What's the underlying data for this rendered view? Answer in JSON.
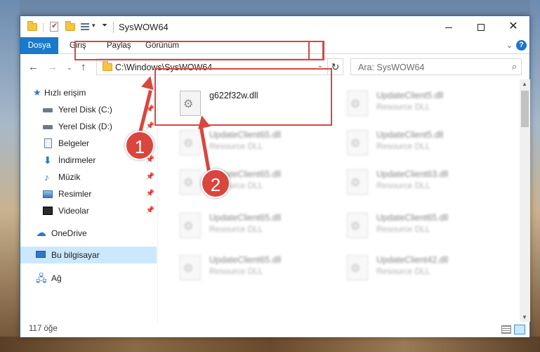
{
  "window": {
    "title": "SysWOW64",
    "minimize_glyph": "—",
    "close_glyph": "✕"
  },
  "quick_access_toolbar": {
    "dropdown_glyph": "▾",
    "customize_glyph": "⏷"
  },
  "ribbon": {
    "tabs": [
      {
        "label": "Dosya",
        "active": true
      },
      {
        "label": "Giriş"
      },
      {
        "label": "Paylaş"
      },
      {
        "label": "Görünüm"
      }
    ],
    "expand_glyph": "⌄",
    "help_glyph": "?"
  },
  "navigation": {
    "back_glyph": "←",
    "forward_glyph": "→",
    "recent_glyph": "⌄",
    "up_glyph": "↑",
    "address_path": "C:\\Windows\\SysWOW64",
    "address_dropdown_glyph": "⌄",
    "refresh_glyph": "↻",
    "search_placeholder": "Ara: SysWOW64",
    "search_glyph": "⌕"
  },
  "sidebar": {
    "items": [
      {
        "label": "Hızlı erişim",
        "icon": "star-icon",
        "pinned": false
      },
      {
        "label": "Yerel Disk (C:)",
        "icon": "disk-icon",
        "pinned": true
      },
      {
        "label": "Yerel Disk (D:)",
        "icon": "disk-icon",
        "pinned": true
      },
      {
        "label": "Belgeler",
        "icon": "document-icon",
        "pinned": true
      },
      {
        "label": "İndirmeler",
        "icon": "download-icon",
        "pinned": true
      },
      {
        "label": "Müzik",
        "icon": "music-icon",
        "pinned": true
      },
      {
        "label": "Resimler",
        "icon": "pictures-icon",
        "pinned": true
      },
      {
        "label": "Videolar",
        "icon": "video-icon",
        "pinned": true
      },
      {
        "label": "OneDrive",
        "icon": "cloud-icon",
        "pinned": false
      },
      {
        "label": "Bu bilgisayar",
        "icon": "computer-icon",
        "pinned": false,
        "selected": true
      },
      {
        "label": "Ağ",
        "icon": "network-icon",
        "pinned": false
      }
    ],
    "pin_glyph": "📌",
    "star_glyph": "★",
    "download_glyph": "⬇",
    "music_glyph": "♪",
    "cloud_glyph": "☁",
    "network_glyph": "🖧"
  },
  "files": [
    {
      "name": "g622f32w.dll",
      "type": "",
      "highlighted": true
    },
    {
      "name": "UpdateClient5.dll",
      "type": "Resource DLL"
    },
    {
      "name": "UpdateClient65.dll",
      "type": "Resource DLL"
    },
    {
      "name": "UpdateClient5.dll",
      "type": "Resource DLL"
    },
    {
      "name": "UpdateClient65.dll",
      "type": "Resource DLL"
    },
    {
      "name": "UpdateClient63.dll",
      "type": "Resource DLL"
    },
    {
      "name": "UpdateClient65.dll",
      "type": "Resource DLL"
    },
    {
      "name": "UpdateClient65.dll",
      "type": "Resource DLL"
    },
    {
      "name": "UpdateClient65.dll",
      "type": "Resource DLL"
    },
    {
      "name": "UpdateClient42.dll",
      "type": "Resource DLL"
    }
  ],
  "scrollbar": {
    "up_glyph": "▲",
    "down_glyph": "▼"
  },
  "status": {
    "item_count": "117 öğe"
  },
  "annotations": {
    "color": "#d9463e",
    "callouts": [
      {
        "number": "1"
      },
      {
        "number": "2"
      }
    ]
  },
  "colors": {
    "accent": "#1979ca",
    "selection": "#cce8ff"
  }
}
